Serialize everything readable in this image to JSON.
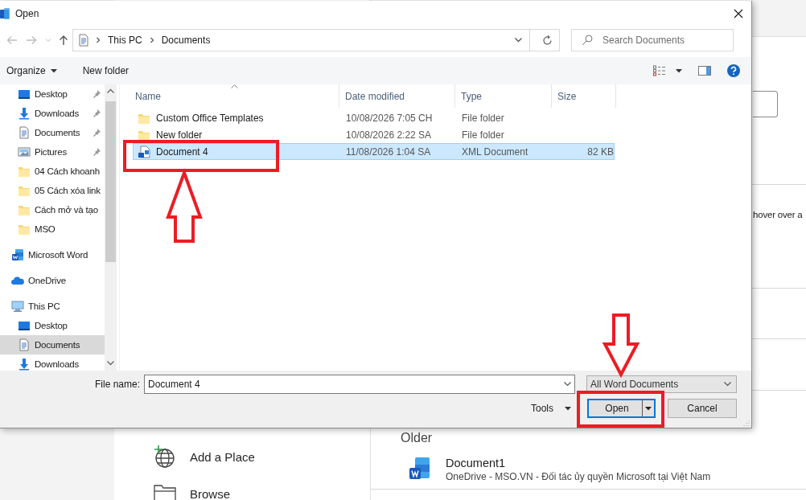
{
  "backstage": {
    "hint": "hover over a",
    "places": [
      {
        "label": "Add a Place",
        "kind": "add_place"
      },
      {
        "label": "Browse",
        "kind": "browse"
      }
    ],
    "recent_heading": "Older",
    "recent_files": [
      {
        "name": "Document1",
        "location": "OneDrive - MSO.VN - Đối tác ủy quyền Microsoft tại Việt Nam"
      }
    ]
  },
  "dialog": {
    "title": "Open",
    "address": {
      "segments": [
        "This PC",
        "Documents"
      ]
    },
    "search": {
      "placeholder": "Search Documents"
    },
    "toolbar": {
      "organize": "Organize",
      "new_folder": "New folder"
    },
    "nav_pane": {
      "quick_access": [
        {
          "label": "Desktop",
          "kind": "desktop",
          "pinned": true,
          "selected": false
        },
        {
          "label": "Downloads",
          "kind": "download",
          "pinned": true,
          "selected": false
        },
        {
          "label": "Documents",
          "kind": "document",
          "pinned": true,
          "selected": false
        },
        {
          "label": "Pictures",
          "kind": "pictures",
          "pinned": true,
          "selected": false
        },
        {
          "label": "04 Cách khoanh",
          "kind": "folder",
          "pinned": false,
          "selected": false
        },
        {
          "label": "05 Cách xóa link",
          "kind": "folder",
          "pinned": false,
          "selected": false
        },
        {
          "label": "Cách mở và tạo",
          "kind": "folder",
          "pinned": false,
          "selected": false
        },
        {
          "label": "MSO",
          "kind": "folder",
          "pinned": false,
          "selected": false
        }
      ],
      "locations": [
        {
          "label": "Microsoft Word",
          "kind": "word",
          "selected": false
        },
        {
          "label": "OneDrive",
          "kind": "cloud",
          "selected": false
        },
        {
          "label": "This PC",
          "kind": "pc",
          "selected": false,
          "children": [
            {
              "label": "Desktop",
              "kind": "desktop",
              "selected": false
            },
            {
              "label": "Documents",
              "kind": "document",
              "selected": true
            },
            {
              "label": "Downloads",
              "kind": "download",
              "selected": false
            }
          ]
        }
      ]
    },
    "files": {
      "columns": [
        {
          "label": "Name",
          "sorted": true
        },
        {
          "label": "Date modified",
          "sorted": false
        },
        {
          "label": "Type",
          "sorted": false
        },
        {
          "label": "Size",
          "sorted": false
        }
      ],
      "rows": [
        {
          "name": "Custom Office Templates",
          "kind": "folder",
          "date": "10/08/2026 7:05 CH",
          "type": "File folder",
          "selected": false
        },
        {
          "name": "New folder",
          "kind": "folder",
          "date": "10/08/2026 2:22 SA",
          "type": "File folder",
          "selected": false
        },
        {
          "name": "Document 4",
          "kind": "word",
          "date": "11/08/2026 1:04 SA",
          "type": "XML Document",
          "size": "82 KB",
          "selected": true
        }
      ]
    },
    "file_name": {
      "label": "File name:",
      "value": "Document 4"
    },
    "file_type": {
      "value": "All Word Documents"
    },
    "tools": "Tools",
    "buttons": [
      {
        "label": "Open",
        "kind": "split",
        "default": true
      },
      {
        "label": "Cancel",
        "kind": "plain",
        "default": false
      }
    ]
  },
  "annotations": [
    {
      "kind": "frame"
    },
    {
      "kind": "arrow_up"
    },
    {
      "kind": "frame"
    },
    {
      "kind": "arrow_down"
    }
  ]
}
